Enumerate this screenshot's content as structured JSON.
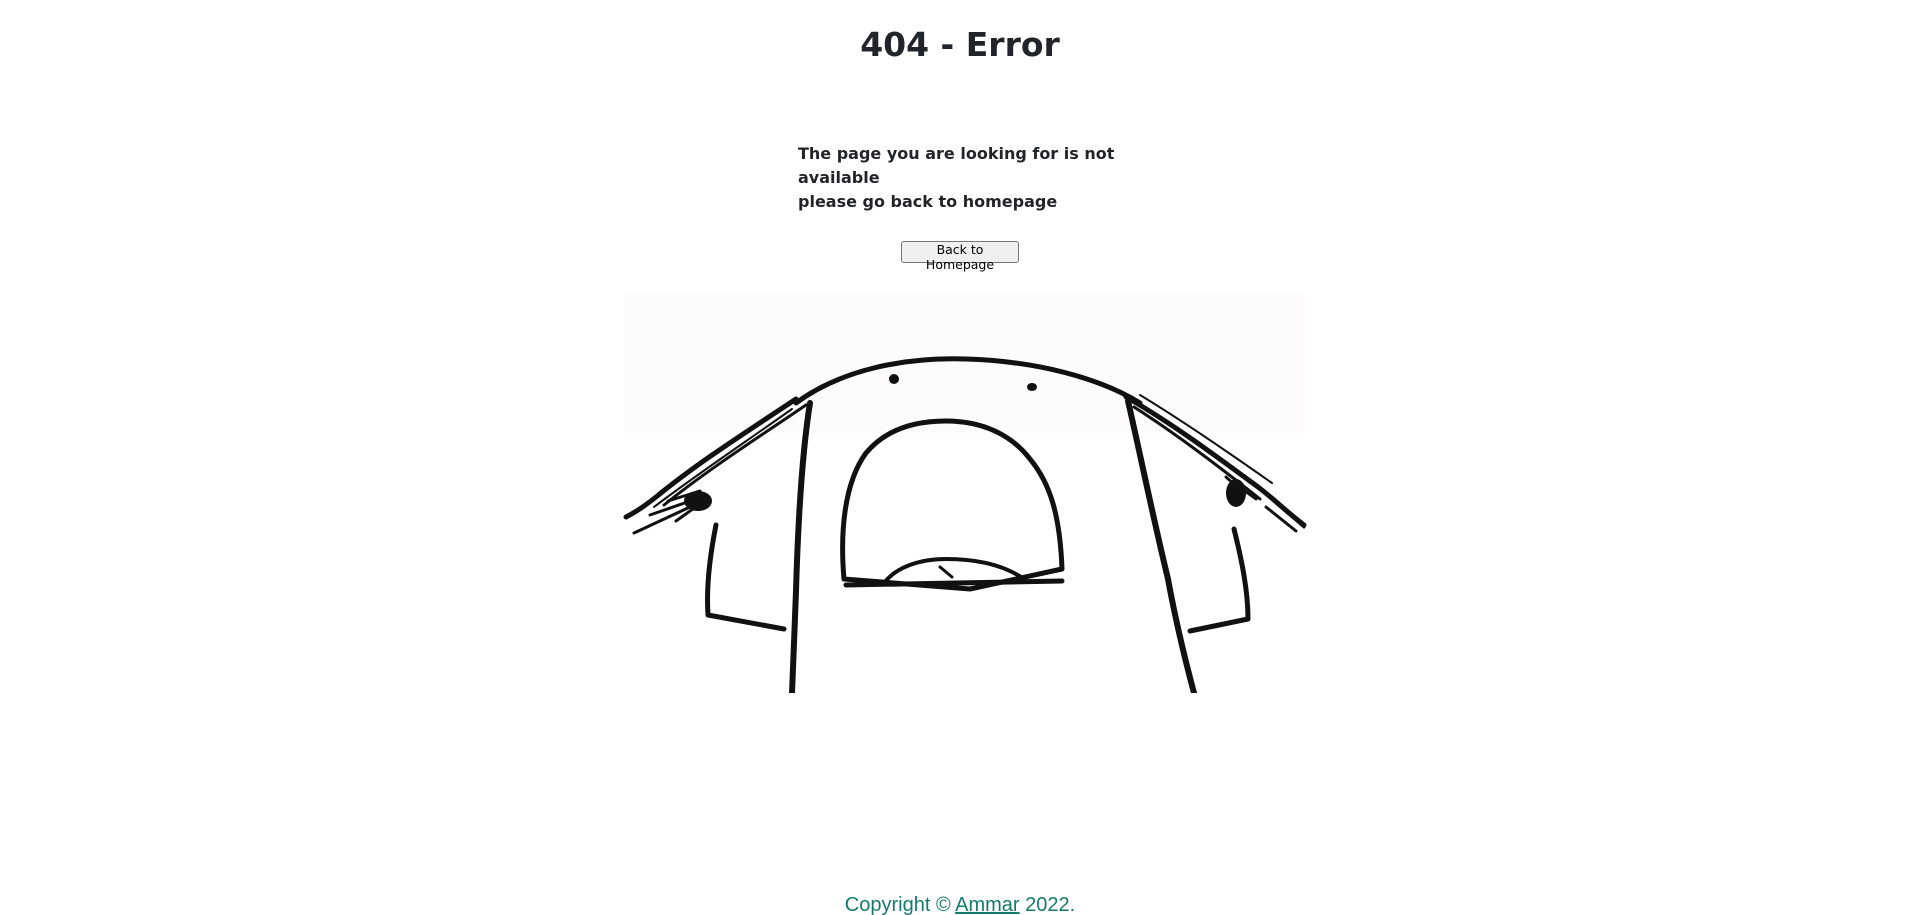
{
  "title": "404 - Error",
  "message": {
    "line1": "The page you are looking for is not available",
    "line2": "please go back to homepage"
  },
  "button": {
    "label": "Back to Homepage"
  },
  "illustration": {
    "icon": "crying-face-drawing-icon"
  },
  "footer": {
    "prefix": "Copyright © ",
    "author": "Ammar",
    "suffix": " 2022."
  },
  "colors": {
    "text": "#212529",
    "footer": "#157a6e"
  }
}
